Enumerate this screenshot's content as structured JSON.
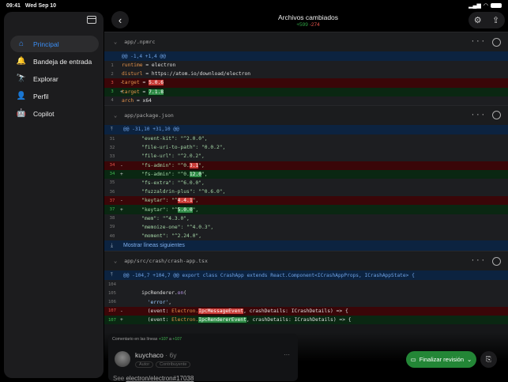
{
  "status": {
    "time": "09:41",
    "date": "Wed Sep 10"
  },
  "sidebar": {
    "items": [
      {
        "label": "Principal",
        "icon": "home-icon",
        "glyph": "⌂",
        "active": true
      },
      {
        "label": "Bandeja de entrada",
        "icon": "bell-icon",
        "glyph": "🔔"
      },
      {
        "label": "Explorar",
        "icon": "telescope-icon",
        "glyph": "🔭"
      },
      {
        "label": "Perfil",
        "icon": "person-icon",
        "glyph": "👤"
      },
      {
        "label": "Copilot",
        "icon": "copilot-icon",
        "glyph": "🤖"
      }
    ]
  },
  "header": {
    "title": "Archivos cambiados",
    "additions": "+599",
    "deletions": "-274"
  },
  "files": [
    {
      "name": "app/.npmrc",
      "hunk": "@@ -1,4 +1,4 @@",
      "lines": [
        {
          "n": "1",
          "t": "ctx",
          "g": "",
          "seg": [
            [
              "k",
              "runtime"
            ],
            [
              "p",
              " = electron"
            ]
          ]
        },
        {
          "n": "2",
          "t": "ctx",
          "g": "",
          "seg": [
            [
              "k",
              "disturl"
            ],
            [
              "p",
              " = https://atom.io/download/electron"
            ]
          ]
        },
        {
          "n": "3",
          "t": "del",
          "g": "-",
          "seg": [
            [
              "k",
              "target"
            ],
            [
              "p",
              " = "
            ],
            [
              "hl-d",
              "5.0.6"
            ]
          ]
        },
        {
          "n": "3",
          "t": "add",
          "g": "+",
          "seg": [
            [
              "k",
              "target"
            ],
            [
              "p",
              " = "
            ],
            [
              "hl-a",
              "7.1.8"
            ]
          ]
        },
        {
          "n": "4",
          "t": "ctx",
          "g": "",
          "seg": [
            [
              "k",
              "arch"
            ],
            [
              "p",
              " = x64"
            ]
          ]
        }
      ]
    },
    {
      "name": "app/package.json",
      "hunk": "@@ -31,10 +31,10 @@",
      "more": "Mostrar líneas siguientes",
      "lines": [
        {
          "n": "31",
          "t": "ctx",
          "g": "",
          "seg": [
            [
              "str",
              "    \"event-kit\": \"^2.0.0\","
            ]
          ]
        },
        {
          "n": "32",
          "t": "ctx",
          "g": "",
          "seg": [
            [
              "str",
              "    \"file-uri-to-path\": \"0.0.2\","
            ]
          ]
        },
        {
          "n": "33",
          "t": "ctx",
          "g": "",
          "seg": [
            [
              "str",
              "    \"file-url\": \"^2.0.2\","
            ]
          ]
        },
        {
          "n": "34",
          "t": "del",
          "g": "-",
          "seg": [
            [
              "str",
              "    \"fs-admin\": \"^0."
            ],
            [
              "hl-d",
              "3.1"
            ],
            [
              "str",
              "\","
            ]
          ]
        },
        {
          "n": "34",
          "t": "add",
          "g": "+",
          "seg": [
            [
              "str",
              "    \"fs-admin\": \"^0."
            ],
            [
              "hl-a",
              "12.0"
            ],
            [
              "str",
              "\","
            ]
          ]
        },
        {
          "n": "35",
          "t": "ctx",
          "g": "",
          "seg": [
            [
              "str",
              "    \"fs-extra\": \"^6.0.0\","
            ]
          ]
        },
        {
          "n": "36",
          "t": "ctx",
          "g": "",
          "seg": [
            [
              "str",
              "    \"fuzzaldrin-plus\": \"^0.6.0\","
            ]
          ]
        },
        {
          "n": "37",
          "t": "del",
          "g": "-",
          "seg": [
            [
              "str",
              "    \"keytar\": \"^"
            ],
            [
              "hl-d",
              "4.4.1"
            ],
            [
              "str",
              "\","
            ]
          ]
        },
        {
          "n": "37",
          "t": "add",
          "g": "+",
          "seg": [
            [
              "str",
              "    \"keytar\": \"^"
            ],
            [
              "hl-a",
              "5.0.0"
            ],
            [
              "str",
              "\","
            ]
          ]
        },
        {
          "n": "38",
          "t": "ctx",
          "g": "",
          "seg": [
            [
              "str",
              "    \"mem\": \"^4.3.0\","
            ]
          ]
        },
        {
          "n": "39",
          "t": "ctx",
          "g": "",
          "seg": [
            [
              "str",
              "    \"memoize-one\": \"^4.0.3\","
            ]
          ]
        },
        {
          "n": "40",
          "t": "ctx",
          "g": "",
          "seg": [
            [
              "str",
              "    \"moment\": \"^2.24.0\","
            ]
          ]
        }
      ]
    },
    {
      "name": "app/src/crash/crash-app.tsx",
      "hunk": "@@ -104,7 +104,7 @@ export class CrashApp extends React.Component<ICrashAppProps, ICrashAppState> {",
      "lines": [
        {
          "n": "104",
          "t": "ctx",
          "g": "",
          "seg": [
            [
              "p",
              " "
            ]
          ]
        },
        {
          "n": "105",
          "t": "ctx",
          "g": "",
          "seg": [
            [
              "p",
              "    ipcRenderer."
            ],
            [
              "fn",
              "on"
            ],
            [
              "p",
              "("
            ]
          ]
        },
        {
          "n": "106",
          "t": "ctx",
          "g": "",
          "seg": [
            [
              "s",
              "      'error'"
            ],
            [
              "p",
              ","
            ]
          ]
        },
        {
          "n": "107",
          "t": "del",
          "g": "-",
          "seg": [
            [
              "p",
              "      (event: "
            ],
            [
              "ty",
              "Electron."
            ],
            [
              "hl-d",
              "IpcMessageEvent"
            ],
            [
              "p",
              ", crashDetails: ICrashDetails) => {"
            ]
          ]
        },
        {
          "n": "107",
          "t": "add",
          "g": "+",
          "seg": [
            [
              "p",
              "      (event: "
            ],
            [
              "ty",
              "Electron."
            ],
            [
              "hl-a",
              "IpcRendererEvent"
            ],
            [
              "p",
              ", crashDetails: ICrashDetails) => {"
            ]
          ]
        }
      ]
    }
  ],
  "comment": {
    "header_prefix": "Comentario en las líneas",
    "from": "+107",
    "sep": "a",
    "to": "+107",
    "author": "kuychaco",
    "age": "· 6y",
    "badges": [
      "Autor",
      "Contribuyente"
    ],
    "body_prefix": "See",
    "link": "electron/electron#17038"
  },
  "review": {
    "finish_label": "Finalizar revisión"
  },
  "colors": {
    "accent": "#3b8ef5",
    "add": "#2ea043",
    "del": "#e5534b",
    "finish": "#238636"
  }
}
